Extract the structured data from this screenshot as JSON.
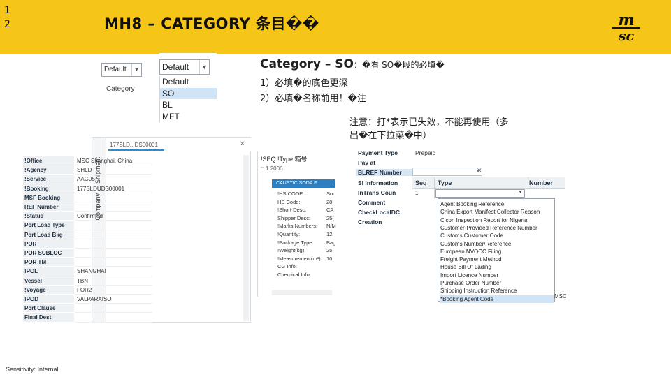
{
  "slide": {
    "numbers": [
      "1",
      "2"
    ],
    "title": "MH8 – CATEGORY 条目��",
    "logo_top": "m",
    "logo_bottom": "sc",
    "footer": "Sensitivity: Internal",
    "header_color": "#F5C518"
  },
  "notes": {
    "heading_prefix": "Category – SO",
    "heading_suffix": "：�看 SO�段的必填�",
    "line1": "1）必填�的底色更深",
    "line2": "2）必填�名称前用！�注",
    "warning_line1": "注意：打*表示已失效，不能再使用（多",
    "warning_line2": "出�在下拉菜�中）"
  },
  "small_dropdown": {
    "value": "Default",
    "label": "Category"
  },
  "category_dropdown": {
    "value": "Default",
    "options": [
      "Default",
      "SO",
      "BL",
      "MFT"
    ],
    "selected_option": "SO"
  },
  "shipment_panel": {
    "vertical_tabs": [
      "Shipment",
      "Company"
    ],
    "tab_label": "177SLD...DS00001",
    "rows": [
      {
        "label": "!Office",
        "value": "MSC Shanghai, China"
      },
      {
        "label": "!Agency",
        "value": "SHLD"
      },
      {
        "label": "!Service",
        "value": "AAG05"
      },
      {
        "label": "!Booking",
        "value": "177SLDUDS00001"
      },
      {
        "label": "MSF Booking",
        "value": ""
      },
      {
        "label": "REF Number",
        "value": ""
      },
      {
        "label": "!Status",
        "value": "Confirmed"
      },
      {
        "label": "Port Load Type",
        "value": ""
      },
      {
        "label": "Port Load Bkg",
        "value": ""
      },
      {
        "label": "POR",
        "value": ""
      },
      {
        "label": "POR SUBLOC",
        "value": ""
      },
      {
        "label": "POR TM",
        "value": ""
      },
      {
        "label": "!POL",
        "value": "SHANGHAI"
      },
      {
        "label": "Vessel",
        "value": "TBN"
      },
      {
        "label": "!Voyage",
        "value": "FOR2"
      },
      {
        "label": "!POD",
        "value": "VALPARAISO"
      },
      {
        "label": "Port Clause",
        "value": ""
      },
      {
        "label": "Final Dest",
        "value": ""
      }
    ]
  },
  "detail_panel": {
    "header": "!SEQ  !Type   箱号",
    "subheader": "□ 1   2000",
    "band": "CAUSTIC SODA F",
    "rows": [
      {
        "label": "!HS CODE:",
        "value": "Sod"
      },
      {
        "label": "HS Code:",
        "value": "28:"
      },
      {
        "label": "!Short Desc:",
        "value": "CA"
      },
      {
        "label": "Shipper Desc:",
        "value": "25("
      },
      {
        "label": "!Marks Numbers:",
        "value": "N/M"
      },
      {
        "label": "!Quantity:",
        "value": "12"
      },
      {
        "label": "!Package Type:",
        "value": "Bag"
      },
      {
        "label": "!Weight(kg):",
        "value": "25,"
      },
      {
        "label": "!Measurement(m³):",
        "value": "10."
      },
      {
        "label": "CG Info:",
        "value": ""
      },
      {
        "label": "Chemical Info:",
        "value": ""
      }
    ]
  },
  "right_panel": {
    "labels": [
      "Payment Type",
      "Pay at",
      "BLREF Number",
      "SI Information",
      "InTrans Coun",
      "Comment",
      "CheckLocalDC",
      "Creation"
    ],
    "prepaid": "Prepaid",
    "grid_columns": [
      "Seq",
      "Type",
      "Number"
    ],
    "grid_row_seq": "1",
    "type_options": [
      "Agent Booking Reference",
      "China Export Manifest Collector Reason",
      "Cicon Inspection Report for Nigeria",
      "Customer-Provided Reference Number",
      "Customs Customer Code",
      "Customs Number/Reference",
      "European NVOCC Filing",
      "Freight Payment Method",
      "House Bill Of Lading",
      "Import Licence Number",
      "Purchase Order Number",
      "Shipping Instruction Reference",
      "*Booking Agent Code"
    ],
    "highlighted_option": "*Booking Agent Code",
    "tail_text": "MSC"
  }
}
